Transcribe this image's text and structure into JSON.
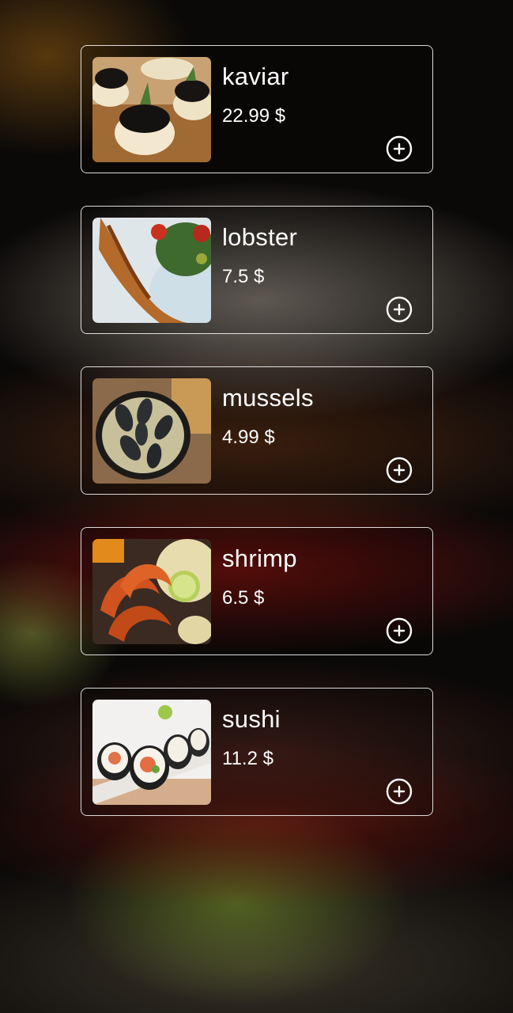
{
  "menu": {
    "items": [
      {
        "name": "kaviar",
        "price": "22.99 $",
        "image_icon": "caviar-canape-photo",
        "add_icon": "plus-circle-icon"
      },
      {
        "name": "lobster",
        "price": "7.5 $",
        "image_icon": "lobster-plate-photo",
        "add_icon": "plus-circle-icon"
      },
      {
        "name": "mussels",
        "price": "4.99 $",
        "image_icon": "mussels-pan-photo",
        "add_icon": "plus-circle-icon"
      },
      {
        "name": "shrimp",
        "price": "6.5 $",
        "image_icon": "shrimp-lime-photo",
        "add_icon": "plus-circle-icon"
      },
      {
        "name": "sushi",
        "price": "11.2 $",
        "image_icon": "sushi-rolls-photo",
        "add_icon": "plus-circle-icon"
      }
    ]
  },
  "colors": {
    "text": "#ffffff",
    "card_border": "#e6e6e6",
    "background": "#0b0908"
  }
}
